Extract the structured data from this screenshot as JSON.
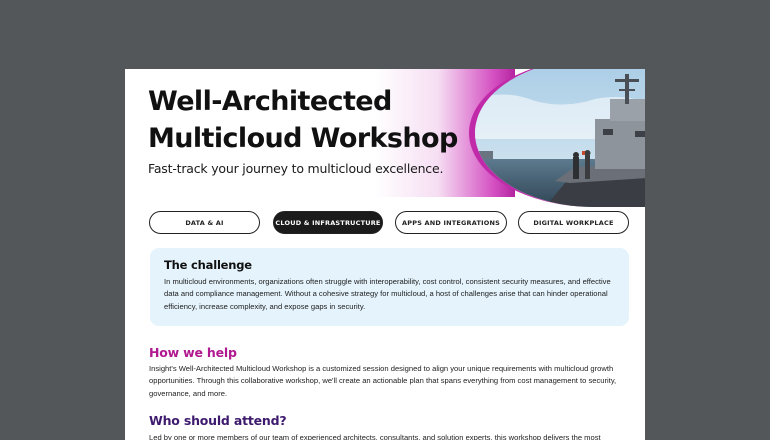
{
  "document": {
    "title_line1": "Well-Architected",
    "title_line2": "Multicloud Workshop",
    "subtitle": "Fast-track your journey to multicloud excellence.",
    "tabs": [
      {
        "label": "DATA & AI",
        "active": false
      },
      {
        "label": "CLOUD & INFRASTRUCTURE",
        "active": true
      },
      {
        "label": "APPS AND INTEGRATIONS",
        "active": false
      },
      {
        "label": "DIGITAL WORKPLACE",
        "active": false
      }
    ],
    "challenge": {
      "heading": "The challenge",
      "text": "In multicloud environments, organizations often struggle with interoperability, cost control, consistent security measures, and effective data and compliance management. Without a cohesive strategy for multicloud, a host of challenges arise that can hinder operational efficiency, increase complexity, and expose gaps in security."
    },
    "how_we_help": {
      "heading": "How we help",
      "text": "Insight's Well-Architected Multicloud Workshop is a customized session designed to align your unique requirements with multicloud growth opportunities. Through this collaborative workshop, we'll create an actionable plan that spans everything from cost management to security, governance, and more."
    },
    "who_should_attend": {
      "heading": "Who should attend?",
      "text": "Led by one or more members of our team of experienced architects, consultants, and solution experts, this workshop delivers the most"
    }
  },
  "colors": {
    "page_background": "#53575a",
    "accent_magenta": "#b0198f",
    "accent_purple": "#3d1a6e",
    "challenge_background": "#e4f3fc"
  },
  "icons": {
    "hero_image": "navy-ship-photo"
  }
}
